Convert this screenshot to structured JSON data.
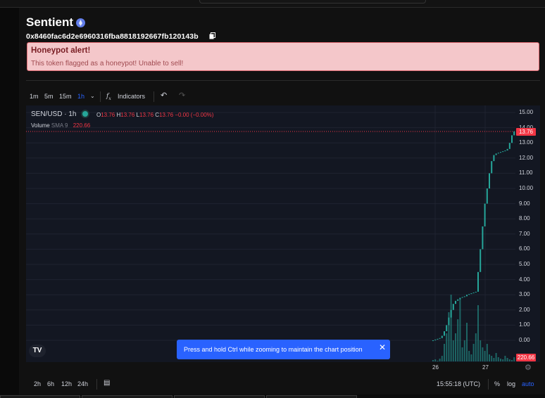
{
  "token": {
    "name": "Sentient",
    "address": "0x8460fac6d2e6960316fba8818192667fb120143b"
  },
  "alert": {
    "title": "Honeypot alert!",
    "message": "This token flagged as a honeypot! Unable to sell!"
  },
  "toolbar": {
    "intervals": [
      "1m",
      "5m",
      "15m",
      "1h"
    ],
    "active_interval": "1h",
    "indicators_label": "Indicators"
  },
  "chart": {
    "symbol_label": "SEN/USD · 1h",
    "ohlc": {
      "o_label": "O",
      "o": "13.76",
      "h_label": "H",
      "h": "13.76",
      "l_label": "L",
      "l": "13.76",
      "c_label": "C",
      "c": "13.76",
      "change": "−0.00 (−0.00%)"
    },
    "volume_label": "Volume",
    "sma_label": "SMA 9",
    "volume_value": "220.66",
    "last_price_tag": "13.76",
    "volume_tag": "220.66",
    "price_axis": [
      "15.00",
      "14.00",
      "13.00",
      "12.00",
      "11.00",
      "10.00",
      "9.00",
      "8.00",
      "7.00",
      "6.00",
      "5.00",
      "4.00",
      "3.00",
      "2.00",
      "1.00",
      "0.00"
    ],
    "time_axis": [
      "26",
      "27"
    ],
    "up_color": "#26a69a",
    "down_color": "#f23645"
  },
  "toast": {
    "message": "Press and hold Ctrl while zooming to maintain the chart position"
  },
  "bottombar": {
    "ranges": [
      "2h",
      "6h",
      "12h",
      "24h"
    ],
    "clock": "15:55:18 (UTC)",
    "percent_label": "%",
    "log_label": "log",
    "auto_label": "auto"
  },
  "colors": {
    "accent": "#2962ff",
    "alert_bg": "#f4c7ca",
    "alert_border": "#e06a72"
  }
}
